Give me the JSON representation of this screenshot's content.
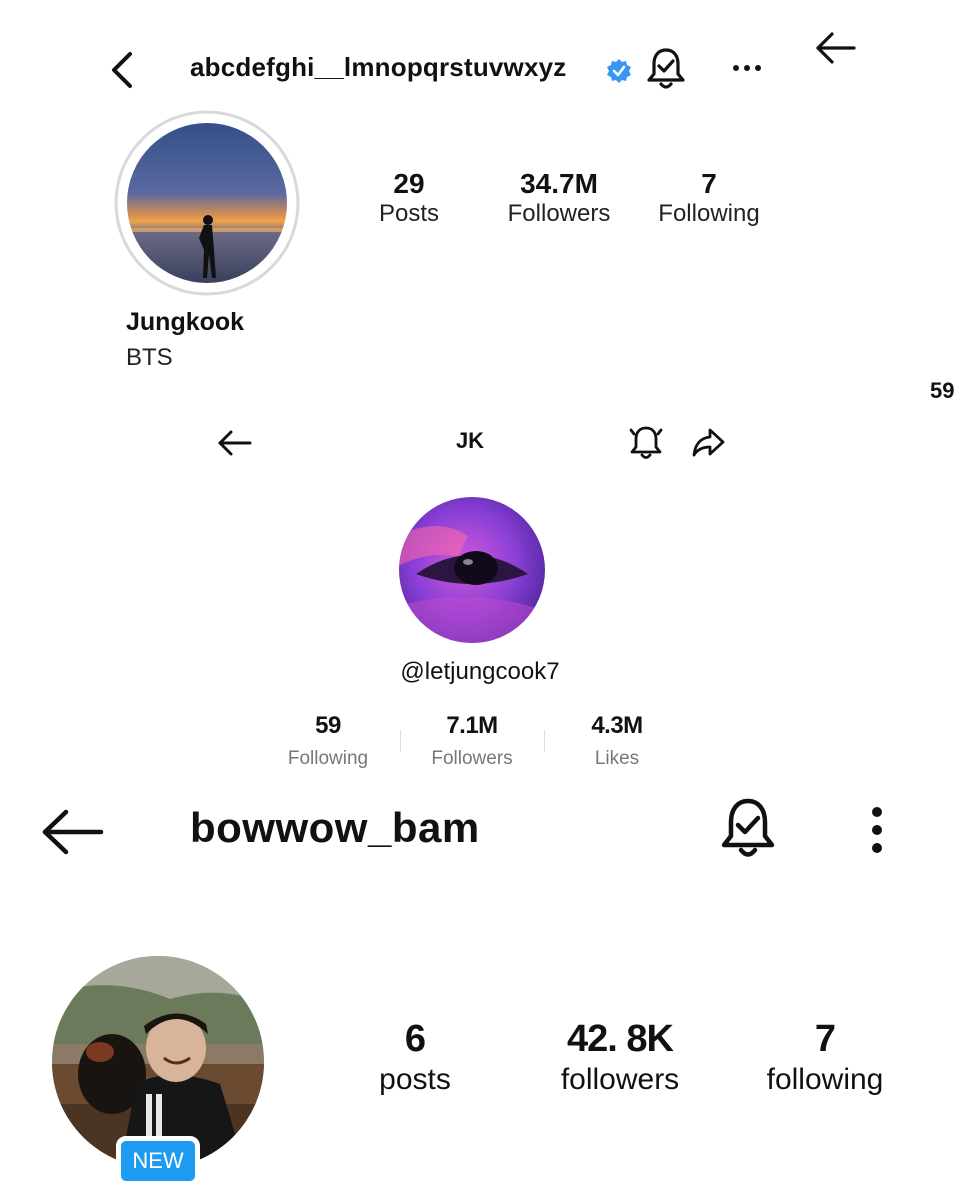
{
  "instagram": {
    "username": "abcdefghi__lmnopqrstuvwxyz",
    "verified_color": "#3897f0",
    "stats": [
      {
        "value": "29",
        "label": "Posts"
      },
      {
        "value": "34.7M",
        "label": "Followers"
      },
      {
        "value": "7",
        "label": "Following"
      }
    ],
    "name": "Jungkook",
    "bio": "BTS",
    "icons": [
      "back-chevron-icon",
      "verified-badge-icon",
      "notification-bell-icon",
      "more-horizontal-icon",
      "back-arrow-icon"
    ]
  },
  "edge_fragment": "59",
  "tiktok": {
    "title": "JK",
    "handle": "@letjungcook7",
    "stats": [
      {
        "value": "59",
        "label": "Following"
      },
      {
        "value": "7.1M",
        "label": "Followers"
      },
      {
        "value": "4.3M",
        "label": "Likes"
      }
    ],
    "icons": [
      "back-arrow-icon",
      "notification-bell-icon",
      "share-icon"
    ]
  },
  "bowwow": {
    "username": "bowwow_bam",
    "stats": [
      {
        "value": "6",
        "label": "posts"
      },
      {
        "value": "42. 8K",
        "label": "followers"
      },
      {
        "value": "7",
        "label": "following"
      }
    ],
    "badge": "NEW",
    "badge_color": "#1d9bf0",
    "icons": [
      "back-arrow-icon",
      "notification-bell-icon",
      "more-vertical-icon"
    ]
  }
}
